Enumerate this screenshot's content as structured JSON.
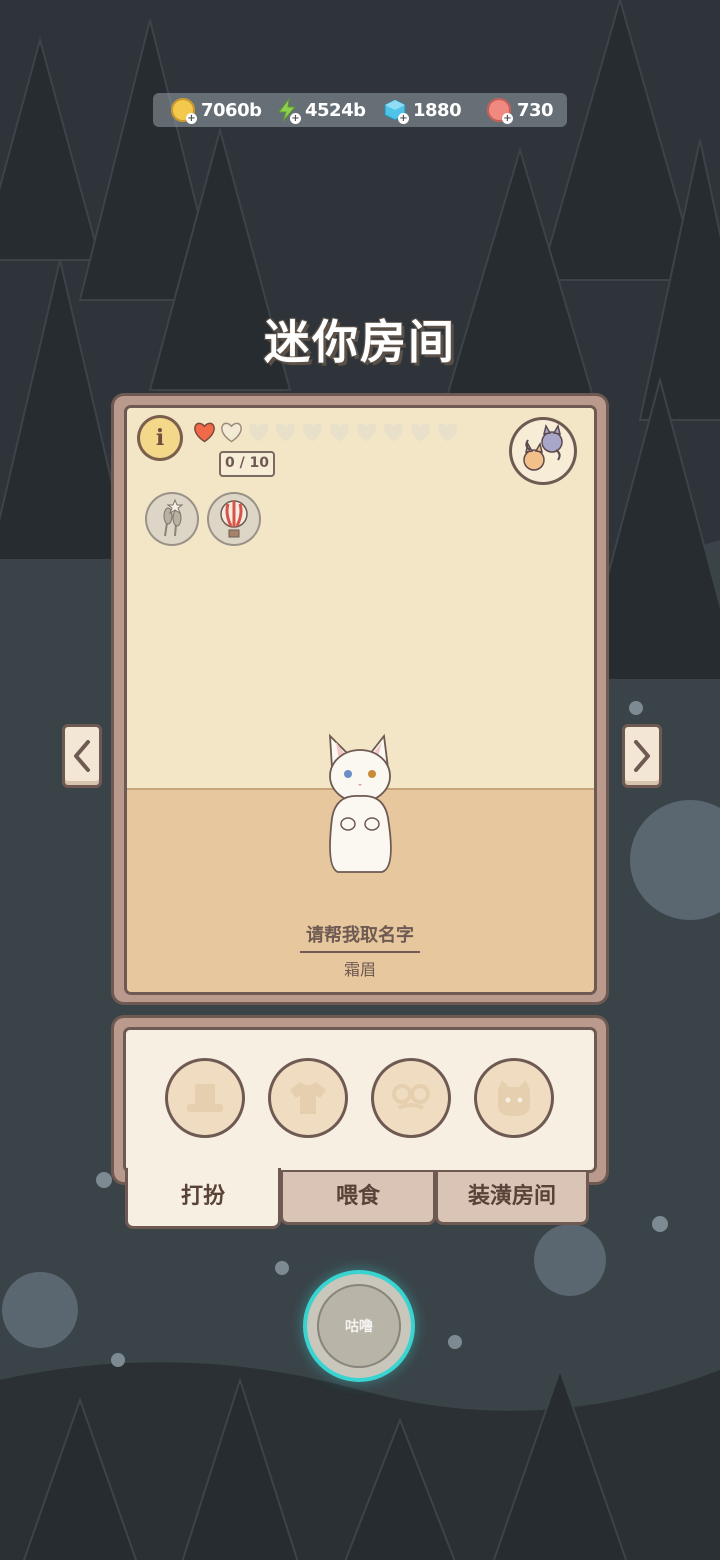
{
  "currencies": [
    {
      "icon": "gold-coin-icon",
      "value": "7060b",
      "color": "#f2c94c"
    },
    {
      "icon": "energy-bolt-icon",
      "value": "4524b",
      "color": "#8fd14f"
    },
    {
      "icon": "gem-cube-icon",
      "value": "1880",
      "color": "#4fc3e8"
    },
    {
      "icon": "yarn-ball-icon",
      "value": "730",
      "color": "#f08a80"
    }
  ],
  "title": "迷你房间",
  "room": {
    "info_label": "i",
    "hearts_filled": 1,
    "hearts_total": 10,
    "affinity": "0 / 10",
    "name_prompt": "请帮我取名字",
    "name_sub": "霜眉"
  },
  "dress_slots": [
    {
      "icon": "hat-icon"
    },
    {
      "icon": "shirt-icon"
    },
    {
      "icon": "glasses-icon"
    },
    {
      "icon": "cat-face-icon"
    }
  ],
  "tabs": [
    {
      "label": "打扮",
      "active": true
    },
    {
      "label": "喂食",
      "active": false
    },
    {
      "label": "装潢房间",
      "active": false
    }
  ],
  "center_button": {
    "label": "咕噜"
  },
  "colors": {
    "accent": "#39d3d0",
    "frame": "#6e5a52",
    "wall": "#f3e6c6",
    "floor": "#e7c79e"
  }
}
